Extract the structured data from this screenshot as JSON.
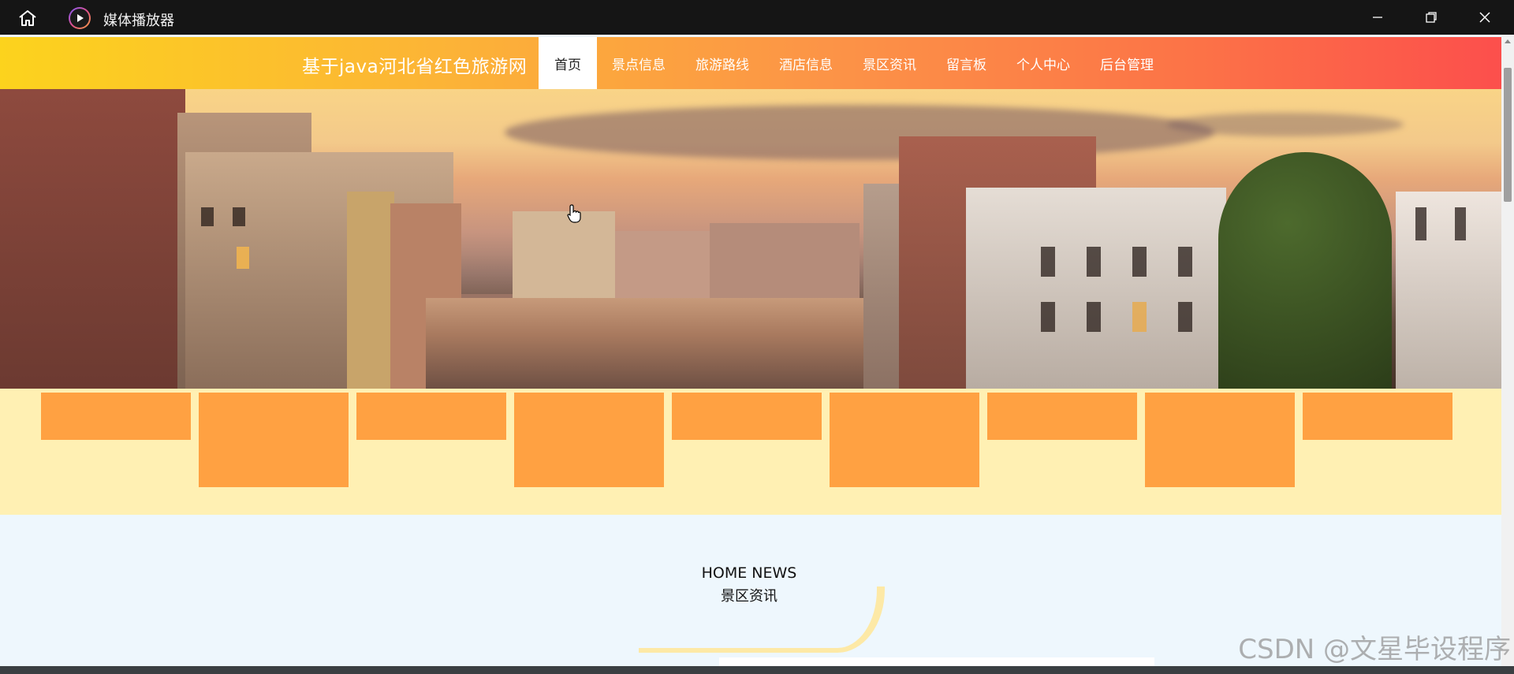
{
  "window": {
    "title": "媒体播放器",
    "icons": {
      "home": "home-icon",
      "app": "play-circle-icon",
      "minimize": "minimize-icon",
      "maximize": "restore-icon",
      "close": "close-icon"
    }
  },
  "site": {
    "logo": "基于java河北省红色旅游网",
    "menu": [
      {
        "label": "首页",
        "active": true
      },
      {
        "label": "景点信息"
      },
      {
        "label": "旅游路线"
      },
      {
        "label": "酒店信息"
      },
      {
        "label": "景区资讯"
      },
      {
        "label": "留言板"
      },
      {
        "label": "个人中心"
      },
      {
        "label": "后台管理"
      }
    ],
    "colors": {
      "nav_start": "#fcd31d",
      "nav_end": "#fc4f4c",
      "tile": "#ffa142",
      "tiles_bg": "#fff0b3",
      "news_bg": "#eef7fd",
      "dot_active": "#f8ea05",
      "dot_inactive": "#c8c8c8"
    }
  },
  "carousel": {
    "slides": 3,
    "active_index": 3
  },
  "tiles": [
    {
      "tall": false
    },
    {
      "tall": true
    },
    {
      "tall": false
    },
    {
      "tall": true
    },
    {
      "tall": false
    },
    {
      "tall": true
    },
    {
      "tall": false
    },
    {
      "tall": true
    },
    {
      "tall": false
    }
  ],
  "news": {
    "title_en": "HOME NEWS",
    "title_cn": "景区资讯"
  },
  "watermark": "CSDN @文星毕设程序"
}
